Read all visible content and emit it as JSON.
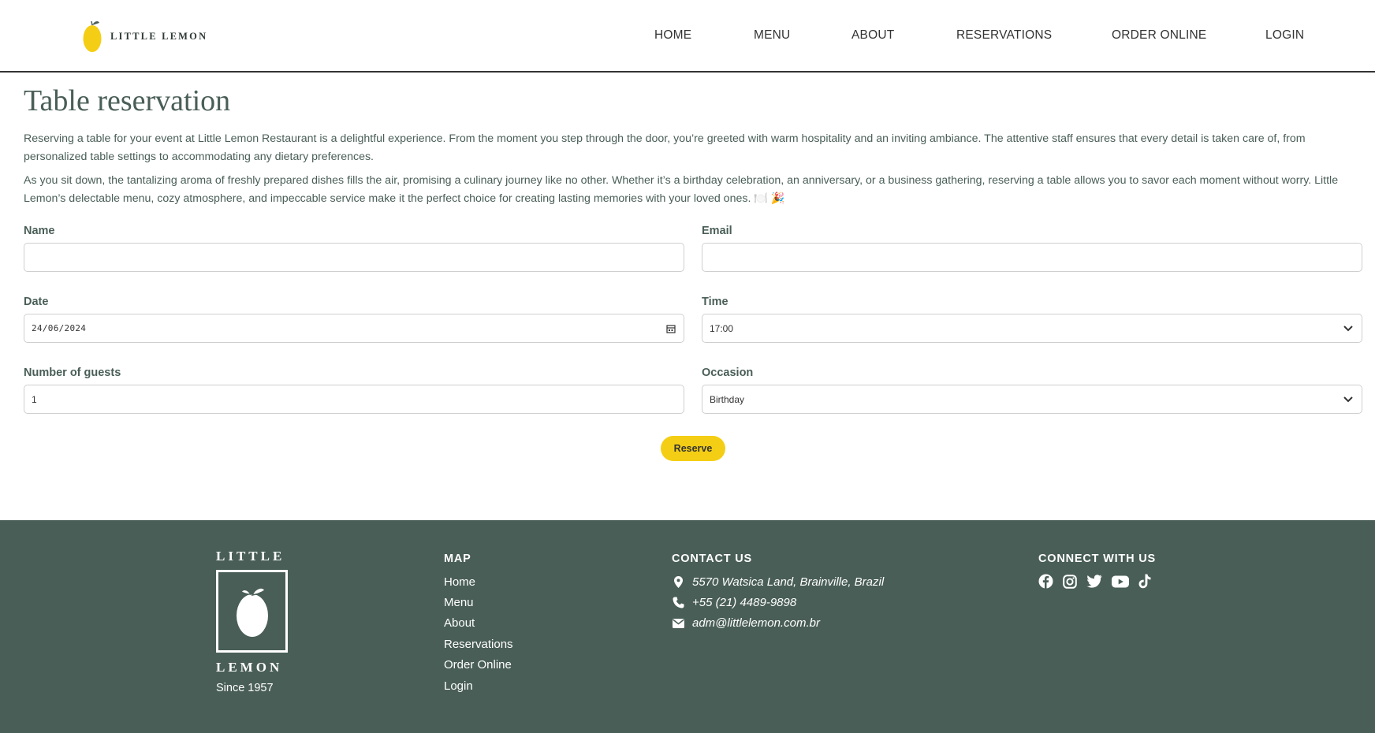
{
  "header": {
    "logo_text": "LITTLE LEMON",
    "nav": [
      {
        "label": "HOME"
      },
      {
        "label": "MENU"
      },
      {
        "label": "ABOUT"
      },
      {
        "label": "RESERVATIONS"
      },
      {
        "label": "ORDER ONLINE"
      },
      {
        "label": "LOGIN"
      }
    ]
  },
  "main": {
    "title": "Table reservation",
    "paragraph1": "Reserving a table for your event at Little Lemon Restaurant is a delightful experience. From the moment you step through the door, you’re greeted with warm hospitality and an inviting ambiance. The attentive staff ensures that every detail is taken care of, from personalized table settings to accommodating any dietary preferences.",
    "paragraph2": "As you sit down, the tantalizing aroma of freshly prepared dishes fills the air, promising a culinary journey like no other. Whether it’s a birthday celebration, an anniversary, or a business gathering, reserving a table allows you to savor each moment without worry. Little Lemon’s delectable menu, cozy atmosphere, and impeccable service make it the perfect choice for creating lasting memories with your loved ones. 🍽️ 🎉"
  },
  "form": {
    "name_label": "Name",
    "name_value": "",
    "email_label": "Email",
    "email_value": "",
    "date_label": "Date",
    "date_value": "24/06/2024",
    "time_label": "Time",
    "time_value": "17:00",
    "guests_label": "Number of guests",
    "guests_value": "1",
    "occasion_label": "Occasion",
    "occasion_value": "Birthday",
    "reserve_label": "Reserve"
  },
  "footer": {
    "logo_top": "LITTLE",
    "logo_bottom": "LEMON",
    "since": "Since 1957",
    "map_heading": "MAP",
    "map_links": [
      "Home",
      "Menu",
      "About",
      "Reservations",
      "Order Online",
      "Login"
    ],
    "contact_heading": "CONTACT US",
    "address": "5570 Watsica Land, Brainville, Brazil",
    "phone": "+55 (21) 4489-9898",
    "email": "adm@littlelemon.com.br",
    "connect_heading": "CONNECT WITH US",
    "socials": [
      "facebook-icon",
      "instagram-icon",
      "twitter-icon",
      "youtube-icon",
      "tiktok-icon"
    ]
  },
  "colors": {
    "primary_green": "#495e57",
    "accent_yellow": "#f4ce14"
  }
}
